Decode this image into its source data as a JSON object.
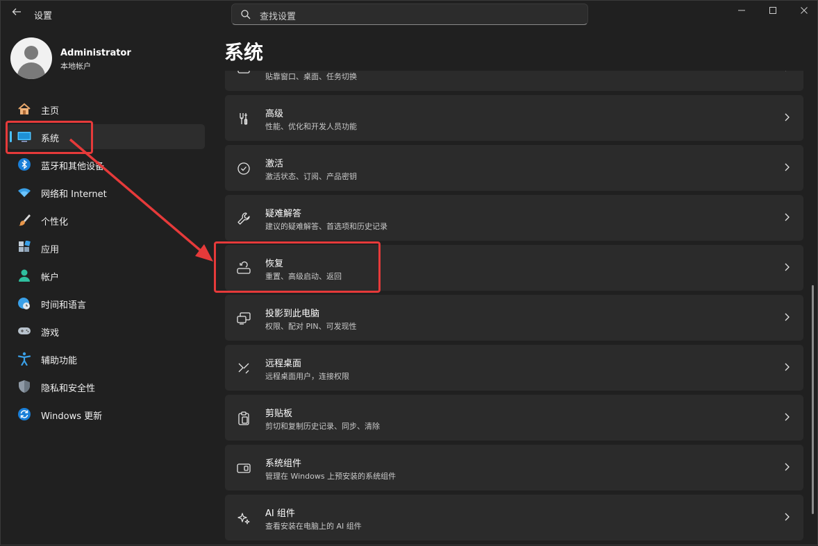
{
  "window": {
    "title": "设置",
    "controls": [
      "minimize",
      "maximize",
      "close"
    ]
  },
  "search": {
    "placeholder": "查找设置"
  },
  "profile": {
    "name": "Administrator",
    "account_type": "本地帐户"
  },
  "sidebar": {
    "items": [
      {
        "label": "主页",
        "icon": "home-icon"
      },
      {
        "label": "系统",
        "icon": "system-icon",
        "active": true
      },
      {
        "label": "蓝牙和其他设备",
        "icon": "bluetooth-icon"
      },
      {
        "label": "网络和 Internet",
        "icon": "wifi-icon"
      },
      {
        "label": "个性化",
        "icon": "brush-icon"
      },
      {
        "label": "应用",
        "icon": "apps-icon"
      },
      {
        "label": "帐户",
        "icon": "account-icon"
      },
      {
        "label": "时间和语言",
        "icon": "time-language-icon"
      },
      {
        "label": "游戏",
        "icon": "gamepad-icon"
      },
      {
        "label": "辅助功能",
        "icon": "accessibility-icon"
      },
      {
        "label": "隐私和安全性",
        "icon": "shield-icon"
      },
      {
        "label": "Windows 更新",
        "icon": "update-icon"
      }
    ]
  },
  "main": {
    "title": "系统",
    "cards": [
      {
        "title": "",
        "subtitle": "贴靠窗口、桌面、任务切换",
        "icon": "multitasking-icon"
      },
      {
        "title": "高级",
        "subtitle": "性能、优化和开发人员功能",
        "icon": "tools-icon"
      },
      {
        "title": "激活",
        "subtitle": "激活状态、订阅、产品密钥",
        "icon": "check-circle-icon"
      },
      {
        "title": "疑难解答",
        "subtitle": "建议的疑难解答、首选项和历史记录",
        "icon": "wrench-icon"
      },
      {
        "title": "恢复",
        "subtitle": "重置、高级启动、返回",
        "icon": "recovery-icon"
      },
      {
        "title": "投影到此电脑",
        "subtitle": "权限、配对 PIN、可发现性",
        "icon": "projection-icon"
      },
      {
        "title": "远程桌面",
        "subtitle": "远程桌面用户，连接权限",
        "icon": "remote-desktop-icon"
      },
      {
        "title": "剪贴板",
        "subtitle": "剪切和复制历史记录、同步、清除",
        "icon": "clipboard-icon"
      },
      {
        "title": "系统组件",
        "subtitle": "管理在 Windows 上预安装的系统组件",
        "icon": "system-components-icon"
      },
      {
        "title": "AI 组件",
        "subtitle": "查看安装在电脑上的 AI 组件",
        "icon": "ai-sparkle-icon"
      }
    ]
  },
  "annotations": {
    "highlight_color": "#e63a3a",
    "highlighted_items": [
      "系统",
      "恢复"
    ]
  },
  "colors": {
    "background": "#202020",
    "card": "#2b2b2b",
    "accent": "#4cc2ff"
  }
}
